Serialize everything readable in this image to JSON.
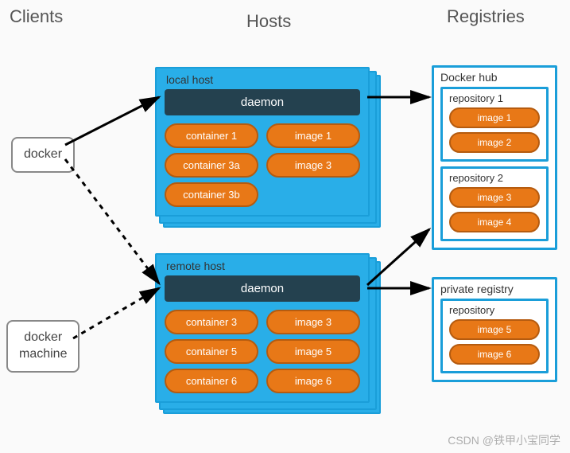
{
  "columns": {
    "clients": "Clients",
    "hosts": "Hosts",
    "registries": "Registries"
  },
  "clients": {
    "docker": "docker",
    "machine": "docker\nmachine"
  },
  "hosts": {
    "local": {
      "title": "local host",
      "daemon": "daemon",
      "containers": [
        "container 1",
        "container 3a",
        "container 3b"
      ],
      "images": [
        "image 1",
        "image 3"
      ]
    },
    "remote": {
      "title": "remote host",
      "daemon": "daemon",
      "containers": [
        "container 3",
        "container 5",
        "container 6"
      ],
      "images": [
        "image 3",
        "image 5",
        "image 6"
      ]
    }
  },
  "registries": {
    "hub": {
      "title": "Docker hub",
      "repos": [
        {
          "title": "repository 1",
          "images": [
            "image 1",
            "image 2"
          ]
        },
        {
          "title": "repository 2",
          "images": [
            "image 3",
            "image 4"
          ]
        }
      ]
    },
    "private": {
      "title": "private registry",
      "repos": [
        {
          "title": "repository",
          "images": [
            "image 5",
            "image 6"
          ]
        }
      ]
    }
  },
  "watermark": "CSDN @铁甲小宝同学"
}
